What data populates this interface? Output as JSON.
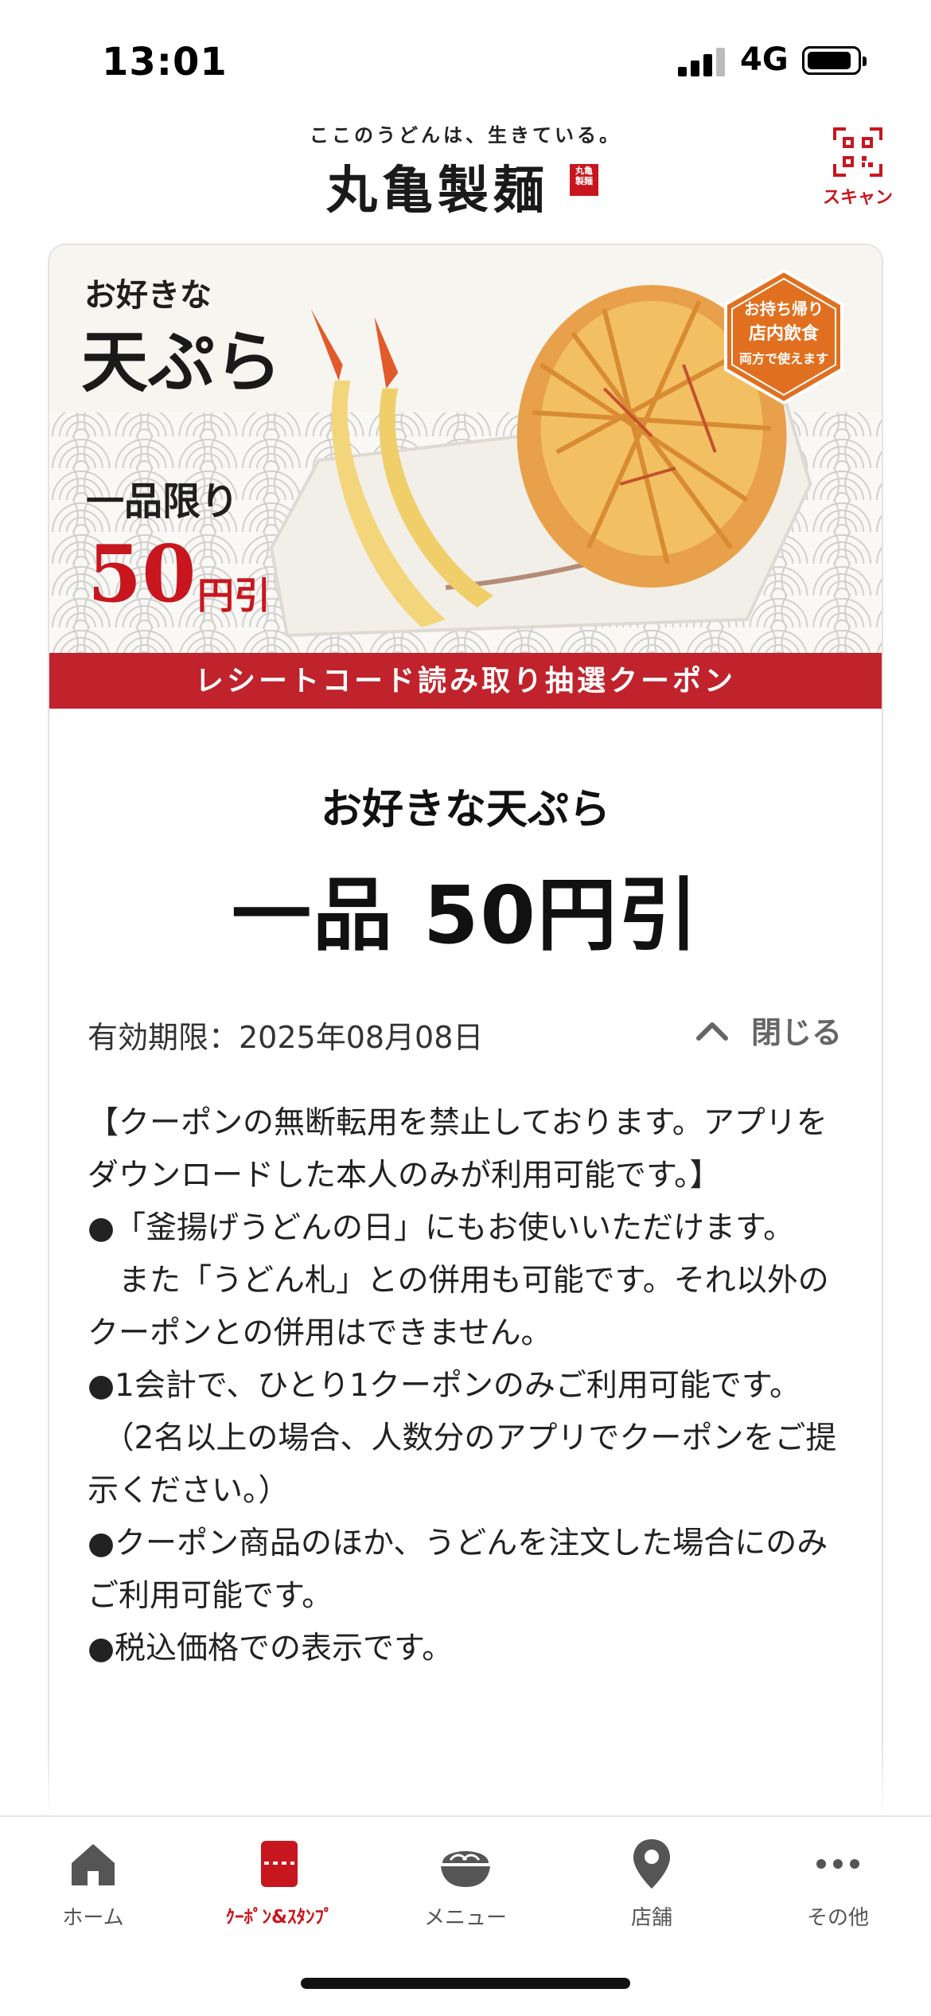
{
  "status_bar": {
    "time": "13:01",
    "network": "4G"
  },
  "header": {
    "tagline": "ここのうどんは、生きている。",
    "brand": "丸亀製麺",
    "seal_text": "丸亀製麺",
    "scan_label": "スキャン"
  },
  "banner": {
    "title_small": "お好きな",
    "title_big": "天ぷら",
    "limit": "一品限り",
    "price": "50",
    "price_unit": "円引",
    "badge_line1": "お持ち帰り",
    "badge_line2": "店内飲食",
    "badge_line3": "両方で使えます",
    "strip": "レシートコード読み取り抽選クーポン"
  },
  "coupon": {
    "title": "お好きな天ぷら",
    "amount": "一品 50円引",
    "validity": "有効期限：2025年08月08日",
    "close_label": "閉じる"
  },
  "notes": [
    "【クーポンの無断転用を禁止しております。アプリをダウンロードした本人のみが利用可能です。】",
    "●「釜揚げうどんの日」にもお使いいただけます。",
    "　また「うどん札」との併用も可能です。それ以外のクーポンとの併用はできません。",
    "●1会計で、ひとり1クーポンのみご利用可能です。",
    "　（2名以上の場合、人数分のアプリでクーポンをご提示ください。）",
    "●クーポン商品のほか、うどんを注文した場合にのみご利用可能です。",
    "●税込価格での表示です。"
  ],
  "tabs": [
    {
      "label": "ホーム",
      "icon": "home-icon"
    },
    {
      "label": "ｸｰﾎﾟﾝ&ｽﾀﾝﾌﾟ",
      "icon": "coupon-icon"
    },
    {
      "label": "メニュー",
      "icon": "bowl-icon"
    },
    {
      "label": "店舗",
      "icon": "location-pin-icon"
    },
    {
      "label": "その他",
      "icon": "more-icon"
    }
  ],
  "colors": {
    "brand_red": "#c8161e",
    "strip_red": "#c0232c",
    "text": "#222222"
  }
}
